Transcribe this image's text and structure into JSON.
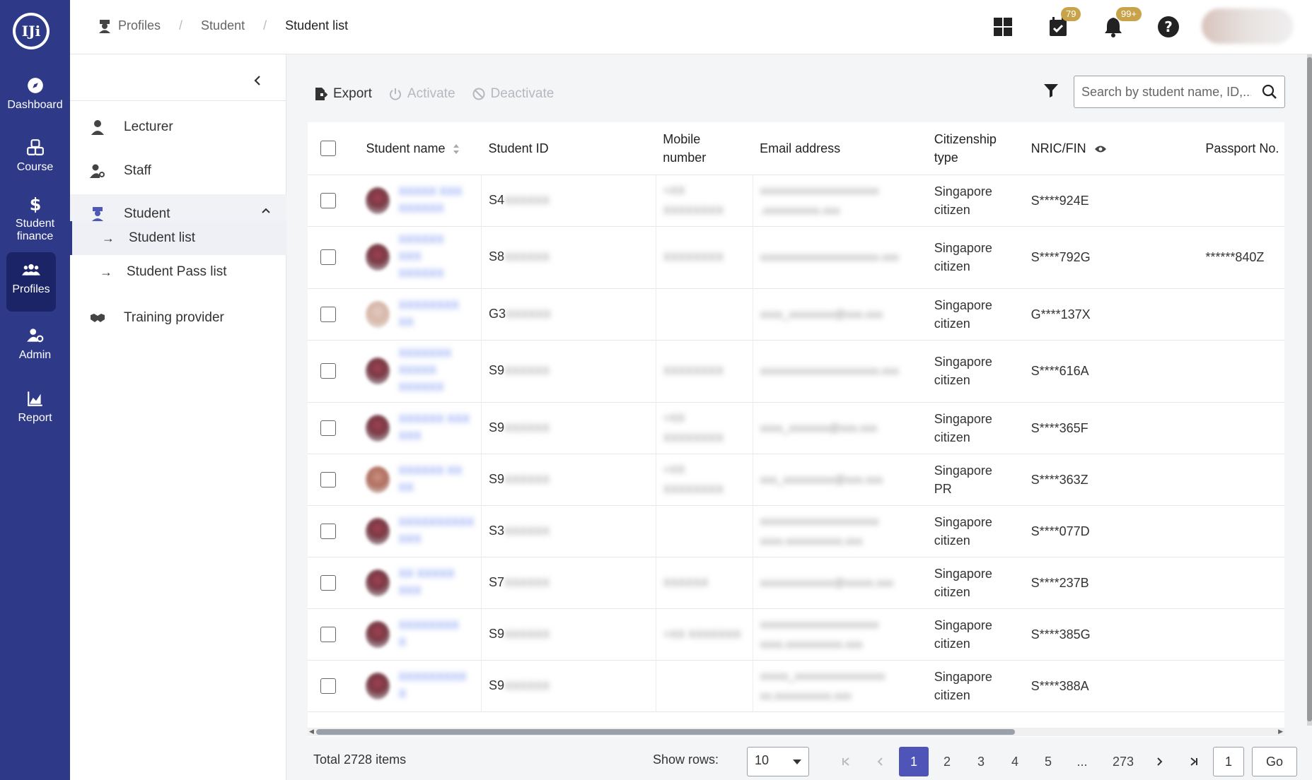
{
  "rail": {
    "logo_text": "IJi",
    "items": [
      {
        "label": "Dashboard",
        "icon": "compass-icon"
      },
      {
        "label": "Course",
        "icon": "boxes-icon"
      },
      {
        "label": "Student\nfinance",
        "label_line1": "Student",
        "label_line2": "finance",
        "icon": "dollar-icon"
      },
      {
        "label": "Profiles",
        "icon": "users-icon"
      },
      {
        "label": "Admin",
        "icon": "user-gear-icon"
      },
      {
        "label": "Report",
        "icon": "chart-icon"
      }
    ]
  },
  "breadcrumb": {
    "items": [
      "Profiles",
      "Student",
      "Student list"
    ]
  },
  "topbar": {
    "tasks_badge": "79",
    "notifications_badge": "99+"
  },
  "subnav": {
    "items": [
      {
        "label": "Lecturer"
      },
      {
        "label": "Staff"
      },
      {
        "label": "Student"
      },
      {
        "label": "Training provider"
      }
    ],
    "student_children": [
      {
        "label": "Student list"
      },
      {
        "label": "Student Pass list"
      }
    ]
  },
  "toolbar": {
    "export_label": "Export",
    "activate_label": "Activate",
    "deactivate_label": "Deactivate",
    "search_placeholder": "Search by student name, ID,..."
  },
  "table": {
    "columns": {
      "name": "Student name",
      "id": "Student ID",
      "mobile_line1": "Mobile",
      "mobile_line2": "number",
      "email": "Email address",
      "citizenship_line1": "Citizenship",
      "citizenship_line2": "type",
      "nric": "NRIC/FIN",
      "passport": "Passport No."
    },
    "rows": [
      {
        "id_prefix": "S4",
        "citizen_line1": "Singapore",
        "citizen_line2": "citizen",
        "nric": "S****924E",
        "passport": ""
      },
      {
        "id_prefix": "S8",
        "citizen_line1": "Singapore",
        "citizen_line2": "citizen",
        "nric": "S****792G",
        "passport": "******840Z"
      },
      {
        "id_prefix": "G3",
        "citizen_line1": "Singapore",
        "citizen_line2": "citizen",
        "nric": "G****137X",
        "passport": ""
      },
      {
        "id_prefix": "S9",
        "citizen_line1": "Singapore",
        "citizen_line2": "citizen",
        "nric": "S****616A",
        "passport": ""
      },
      {
        "id_prefix": "S9",
        "citizen_line1": "Singapore",
        "citizen_line2": "citizen",
        "nric": "S****365F",
        "passport": ""
      },
      {
        "id_prefix": "S9",
        "citizen_line1": "Singapore",
        "citizen_line2": "PR",
        "nric": "S****363Z",
        "passport": ""
      },
      {
        "id_prefix": "S3",
        "citizen_line1": "Singapore",
        "citizen_line2": "citizen",
        "nric": "S****077D",
        "passport": ""
      },
      {
        "id_prefix": "S7",
        "citizen_line1": "Singapore",
        "citizen_line2": "citizen",
        "nric": "S****237B",
        "passport": ""
      },
      {
        "id_prefix": "S9",
        "citizen_line1": "Singapore",
        "citizen_line2": "citizen",
        "nric": "S****385G",
        "passport": ""
      },
      {
        "id_prefix": "S9",
        "citizen_line1": "Singapore",
        "citizen_line2": "citizen",
        "nric": "S****388A",
        "passport": ""
      }
    ]
  },
  "pagination": {
    "total_text": "Total 2728 items",
    "show_rows_label": "Show rows:",
    "rows_per_page": "10",
    "pages": [
      "1",
      "2",
      "3",
      "4",
      "5",
      "...",
      "273"
    ],
    "current_page": "1",
    "goto_value": "1",
    "go_label": "Go"
  },
  "colors": {
    "rail_bg": "#2e3a87",
    "rail_active": "#1b2466",
    "accent": "#4f55b8",
    "badge": "#c9a34a"
  }
}
